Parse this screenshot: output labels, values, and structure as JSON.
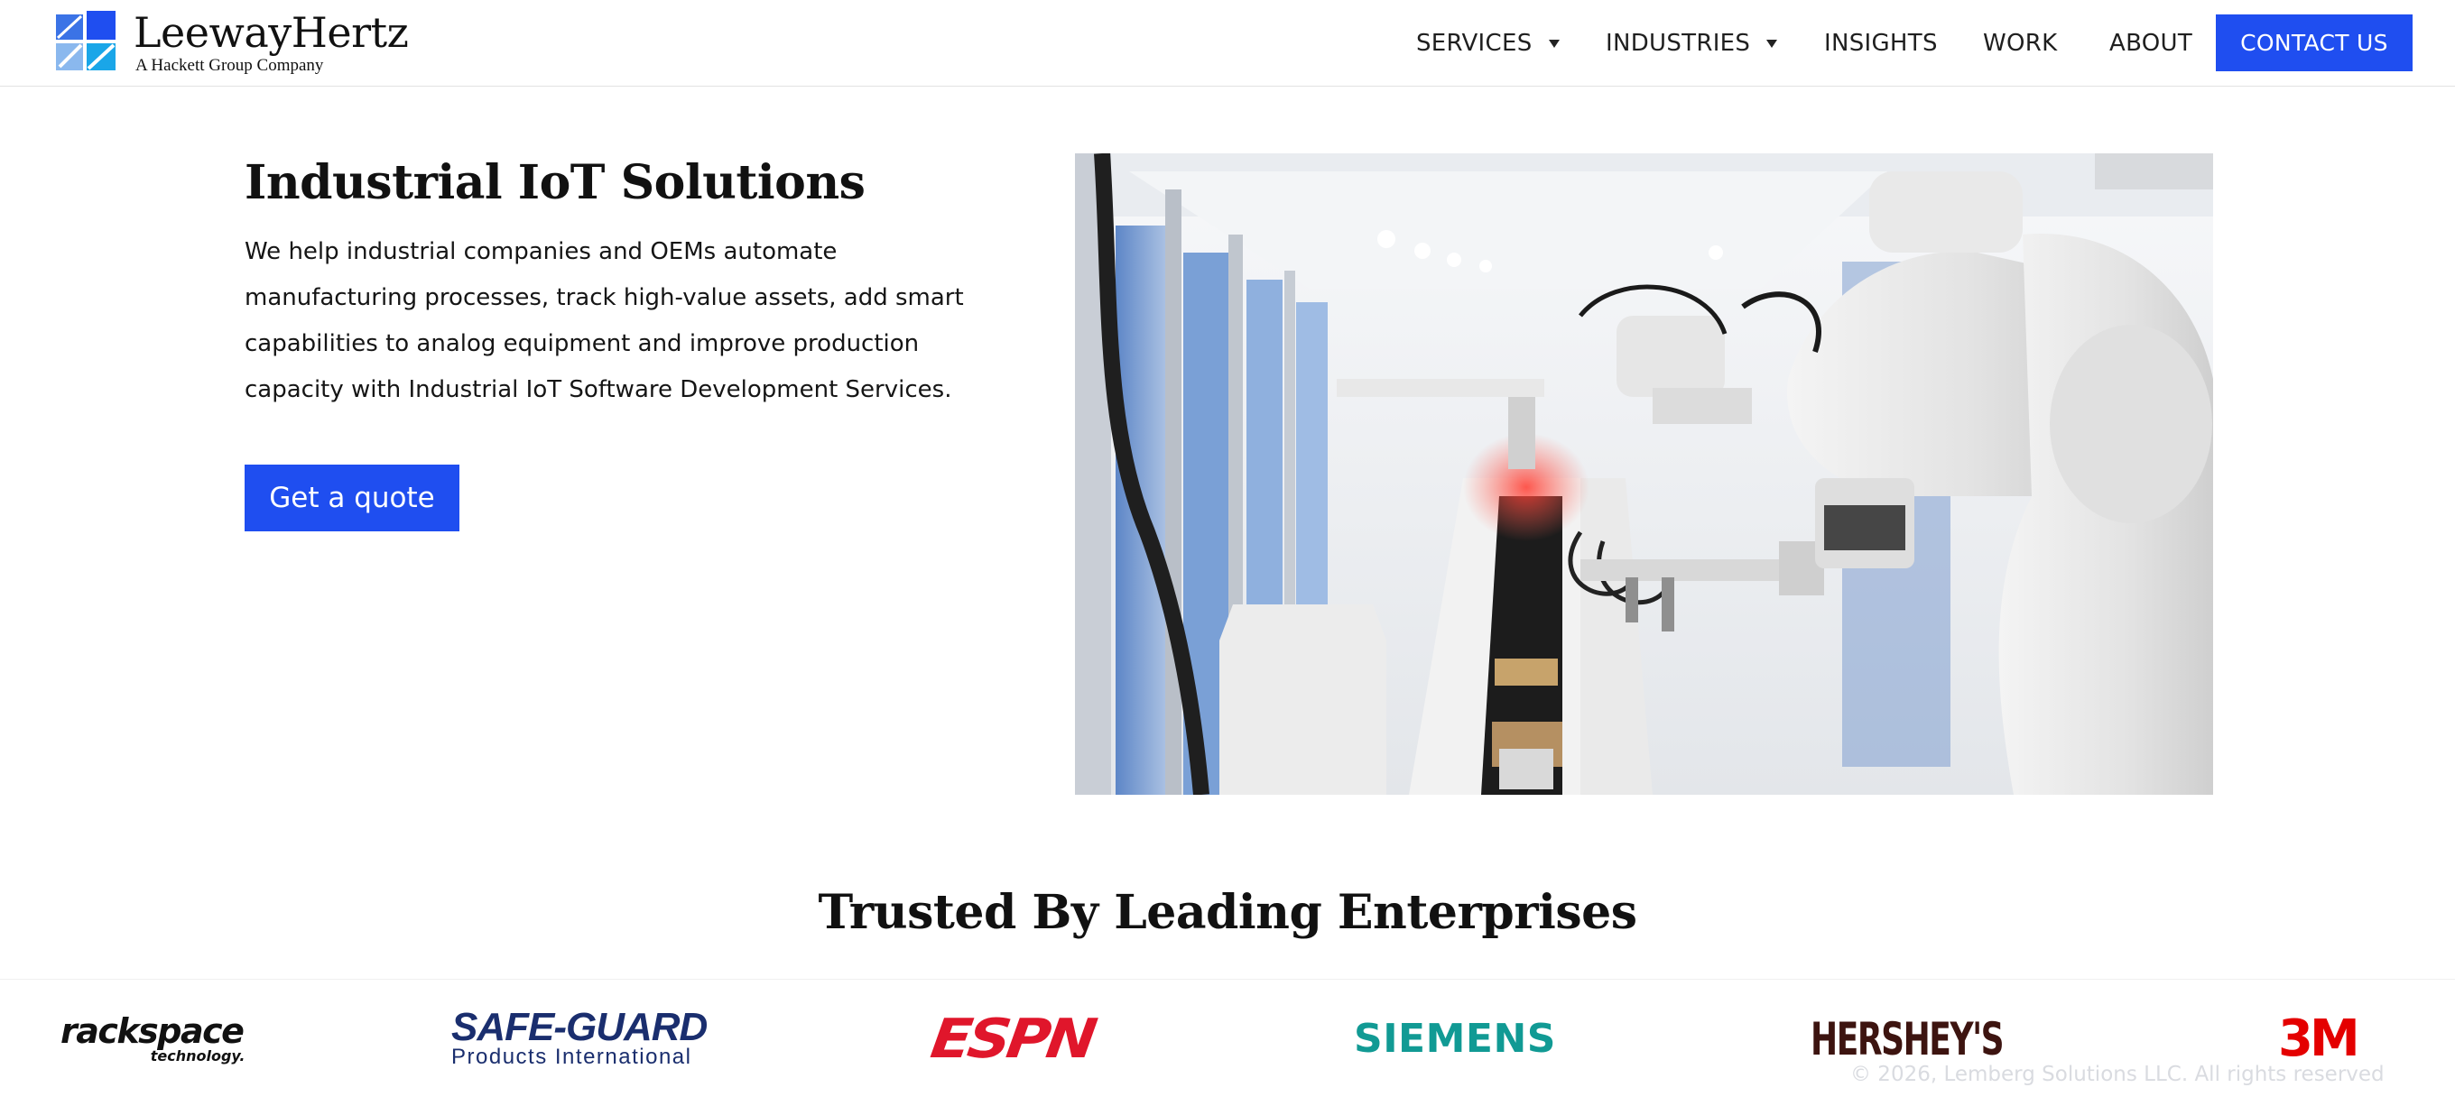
{
  "header": {
    "logo_name": "LeewayHertz",
    "logo_tagline": "A Hackett Group Company",
    "nav": [
      {
        "label": "SERVICES",
        "has_dropdown": true
      },
      {
        "label": "INDUSTRIES",
        "has_dropdown": true
      },
      {
        "label": "INSIGHTS",
        "has_dropdown": false
      },
      {
        "label": "WORK",
        "has_dropdown": false
      },
      {
        "label": "ABOUT",
        "has_dropdown": false
      }
    ],
    "contact_label": "CONTACT US"
  },
  "hero": {
    "title": "Industrial IoT Solutions",
    "description": "We help industrial companies and OEMs automate manufacturing processes, track high-value assets, add smart capabilities to analog equipment and improve production capacity with Industrial IoT Software Development Services.",
    "cta_label": "Get a quote"
  },
  "trusted": {
    "title": "Trusted By Leading Enterprises",
    "clients": {
      "rackspace": {
        "name": "rackspace",
        "sub": "technology."
      },
      "safeguard": {
        "name": "SAFE-GUARD",
        "sub": "Products  International"
      },
      "espn": {
        "name": "ESPN"
      },
      "siemens": {
        "name": "SIEMENS"
      },
      "hersheys": {
        "name": "HERSHEY'S"
      },
      "threem": {
        "name": "3M"
      }
    }
  },
  "footer": {
    "copyright": "© 2026, Lemberg Solutions LLC. All rights reserved"
  },
  "colors": {
    "brand_blue": "#1f4ef0",
    "espn_red": "#e0162b",
    "siemens_teal": "#119a94",
    "hersheys_brown": "#3d1410",
    "threem_red": "#e40000",
    "safeguard_navy": "#1a2e6e"
  }
}
